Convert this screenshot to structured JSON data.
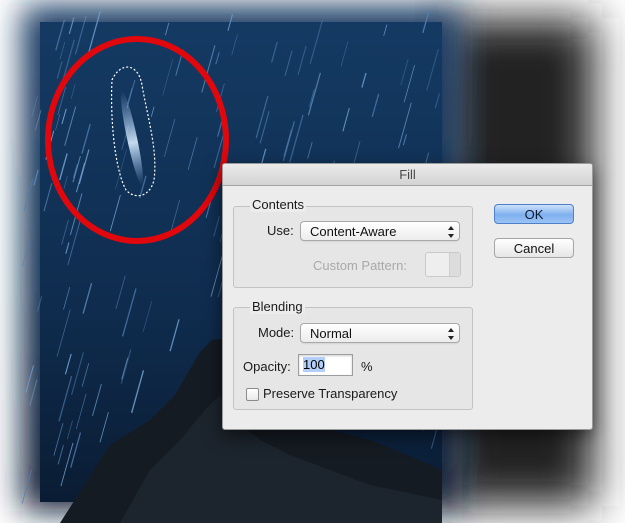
{
  "dialog": {
    "title": "Fill",
    "contents": {
      "legend": "Contents",
      "use_label": "Use:",
      "use_value": "Content-Aware",
      "custom_pattern_label": "Custom Pattern:"
    },
    "blending": {
      "legend": "Blending",
      "mode_label": "Mode:",
      "mode_value": "Normal",
      "opacity_label": "Opacity:",
      "opacity_value": "100",
      "opacity_unit": "%",
      "preserve_transparency_label": "Preserve Transparency",
      "preserve_transparency_checked": false
    },
    "ok_label": "OK",
    "cancel_label": "Cancel"
  },
  "colors": {
    "sky": "#0f2c4e",
    "sky_dark": "#0a1c33",
    "annotation": "#e0070d",
    "dialog_bg": "#ececec",
    "ok_blue": "#7fb0ee"
  }
}
